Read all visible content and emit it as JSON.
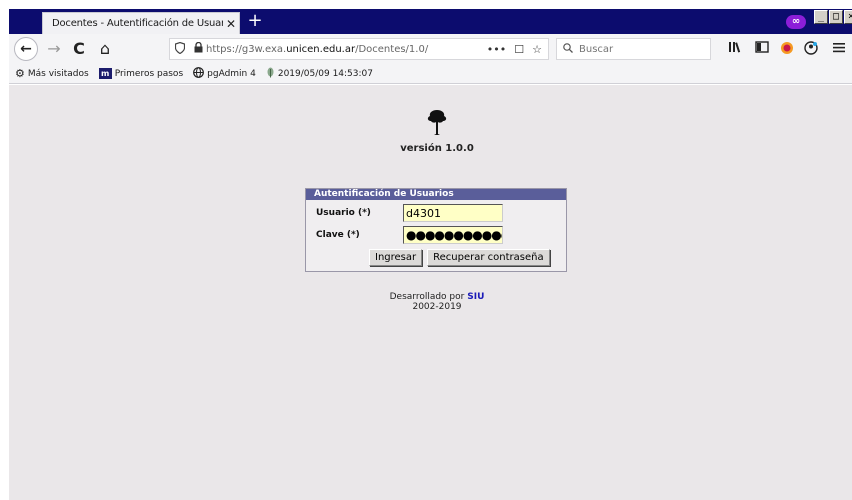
{
  "browser": {
    "tab_title": "Docentes - Autentificación de Usuarios",
    "tab_close": "✕",
    "new_tab": "+",
    "private_badge": "∞",
    "window_buttons": [
      "_",
      "□",
      "×"
    ],
    "url_prefix": "https://g3w.exa.",
    "url_domain": "unicen.edu.ar",
    "url_path": "/Docentes/1.0/",
    "url_actions": [
      "•••",
      "☐",
      "☆"
    ],
    "search_placeholder": "Buscar"
  },
  "toolbar": {
    "back_icon": "←",
    "forward_icon": "→",
    "reload_icon": "C",
    "home_icon": "⌂",
    "right_icons": [
      "library-icon",
      "sidebar-icon",
      "addon-icon",
      "account-icon",
      "menu-icon"
    ]
  },
  "bookmarks": [
    {
      "label": "Más visitados",
      "icon": "gear-icon"
    },
    {
      "label": "Primeros pasos",
      "icon": "m-icon"
    },
    {
      "label": "pgAdmin 4",
      "icon": "globe-icon"
    },
    {
      "label": "2019/05/09 14:53:07",
      "icon": "leaf-icon"
    }
  ],
  "page": {
    "version": "versión 1.0.0",
    "login": {
      "title": "Autentificación de Usuarios",
      "user_label": "Usuario (*)",
      "user_value": "d4301",
      "pass_label": "Clave (*)",
      "pass_value": "●●●●●●●●●●●●●",
      "submit_label": "Ingresar",
      "recover_label": "Recuperar contraseña"
    },
    "footer": {
      "developed_by": "Desarrollado por",
      "org": "SIU",
      "years": "2002-2019"
    }
  },
  "colors": {
    "titlebar": "#0c0c6e",
    "page_bg": "#eae7e9",
    "login_header": "#5a5e9a",
    "input_bg": "#ffffc6",
    "link": "#1a1ab8"
  }
}
